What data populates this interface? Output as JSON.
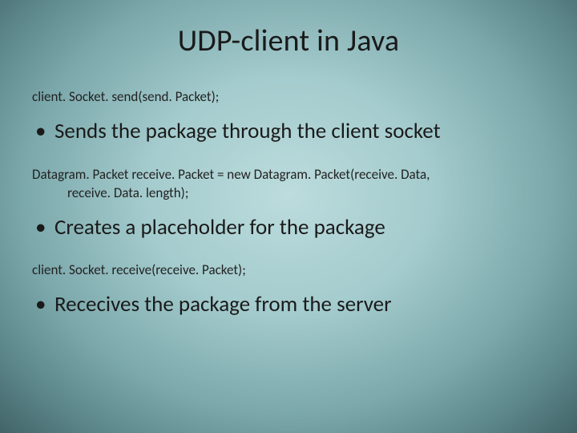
{
  "title": "UDP-client in Java",
  "sections": [
    {
      "code": "client. Socket. send(send. Packet);",
      "code_indent": "",
      "bullet": "Sends the package through the client socket"
    },
    {
      "code": "Datagram. Packet receive. Packet = new Datagram. Packet(receive. Data,",
      "code_indent": "receive. Data. length);",
      "bullet": "Creates a placeholder for the package"
    },
    {
      "code": "client. Socket. receive(receive. Packet);",
      "code_indent": "",
      "bullet": "Rececives the package from the server"
    }
  ]
}
